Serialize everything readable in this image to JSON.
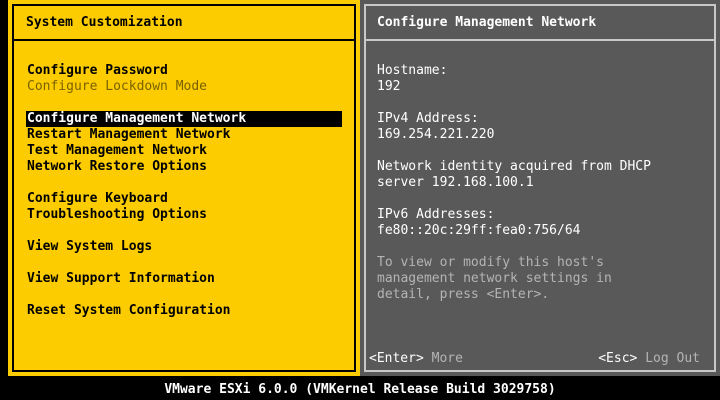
{
  "left_panel": {
    "title": "System Customization",
    "menu": [
      {
        "label": "Configure Password"
      },
      {
        "label": "Configure Lockdown Mode"
      },
      {
        "label": "Configure Management Network"
      },
      {
        "label": "Restart Management Network"
      },
      {
        "label": "Test Management Network"
      },
      {
        "label": "Network Restore Options"
      },
      {
        "label": "Configure Keyboard"
      },
      {
        "label": "Troubleshooting Options"
      },
      {
        "label": "View System Logs"
      },
      {
        "label": "View Support Information"
      },
      {
        "label": "Reset System Configuration"
      }
    ]
  },
  "right_panel": {
    "title": "Configure Management Network",
    "hostname_label": "Hostname:",
    "hostname_value": "192",
    "ipv4_label": "IPv4 Address:",
    "ipv4_value": "169.254.221.220",
    "network_identity_line1": "Network identity acquired from DHCP",
    "network_identity_line2": "server 192.168.100.1",
    "ipv6_label": "IPv6 Addresses:",
    "ipv6_value": "fe80::20c:29ff:fea0:756/64",
    "help_line1": "To view or modify this host's",
    "help_line2": "management network settings in",
    "help_line3": "detail, press <Enter>.",
    "footer": {
      "enter_key": "<Enter>",
      "enter_action": "More",
      "esc_key": "<Esc>",
      "esc_action": "Log Out"
    }
  },
  "status_bar": {
    "text": "VMware ESXi 6.0.0 (VMKernel Release Build 3029758)"
  },
  "colors": {
    "left_panel_bg": "#FCCC00",
    "right_panel_bg": "#595959",
    "selection_bg": "#000000",
    "selection_fg": "#FFFFFF"
  }
}
